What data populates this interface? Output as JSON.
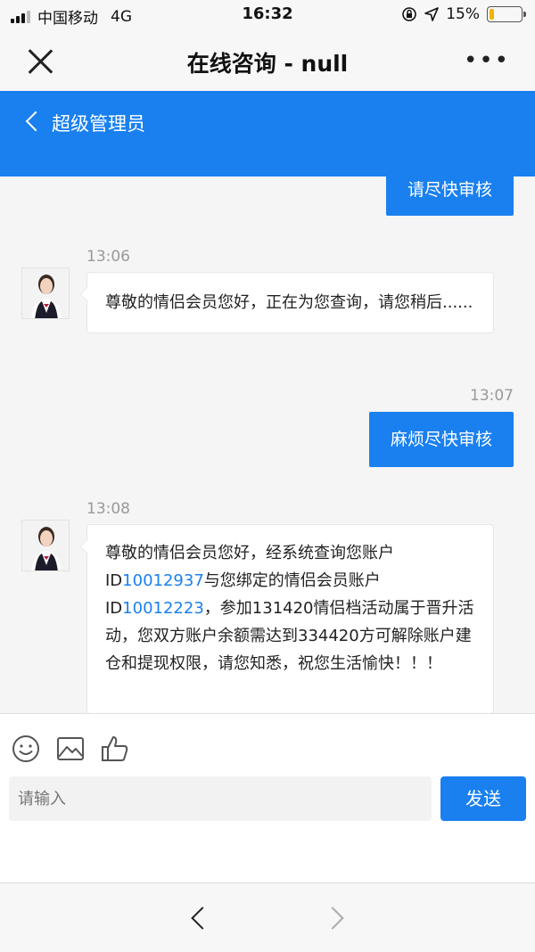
{
  "status_bar": {
    "carrier": "中国移动",
    "network": "4G",
    "time": "16:32",
    "battery": "15%",
    "battery_level": 0.15,
    "signal_bars": 3
  },
  "titlebar": {
    "title": "在线咨询 - null",
    "more": "•••"
  },
  "chat_header": {
    "name": "超级管理员"
  },
  "messages": [
    {
      "side": "right",
      "text": "请尽快审核"
    },
    {
      "side": "left",
      "time": "13:06",
      "text": "尊敬的情侣会员您好，正在为您查询，请您稍后......"
    },
    {
      "side": "right",
      "time": "13:07",
      "text": "麻烦尽快审核"
    },
    {
      "side": "left",
      "time": "13:08",
      "parts": [
        "尊敬的情侣会员您好，经系统查询您账户ID",
        "10012937",
        "与您绑定的情侣会员账户ID",
        "10012223",
        "，参加131420情侣档活动属于晋升活动，您双方账户余额需达到334420方可解除账户建仓和提现权限，请您知悉，祝您生活愉快！！！"
      ]
    }
  ],
  "input": {
    "placeholder": "请输入",
    "send_label": "发送"
  },
  "icons": {
    "emoji": "emoji-icon",
    "image": "image-icon",
    "thumbs_up": "thumbs-up-icon"
  },
  "colors": {
    "accent": "#1a80f0",
    "battery": "#f0b400"
  }
}
